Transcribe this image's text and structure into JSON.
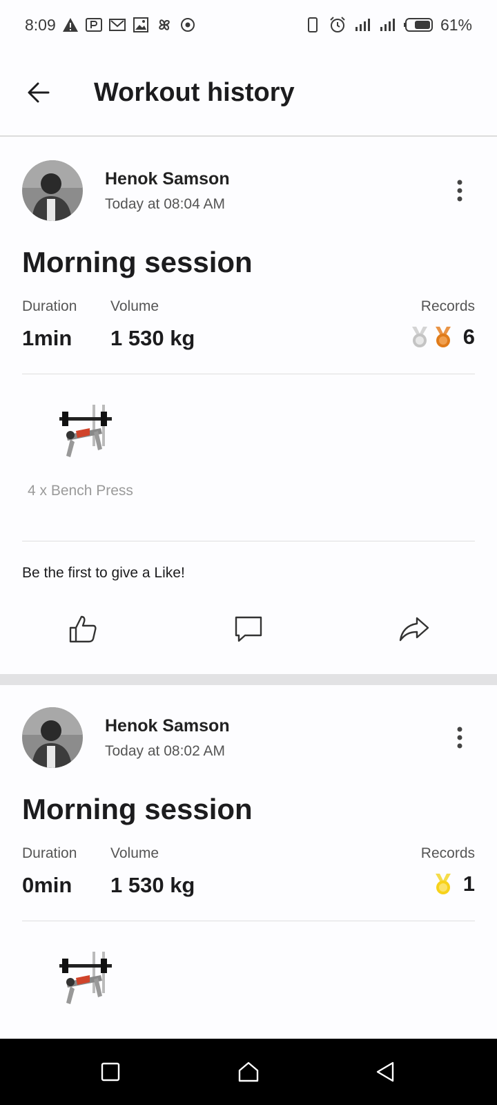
{
  "status_bar": {
    "time": "8:09",
    "battery": "61%",
    "left_icons": [
      "warning-icon",
      "parking-icon",
      "mail-icon",
      "image-icon",
      "pinwheel-icon",
      "target-icon"
    ],
    "right_icons": [
      "phone-icon",
      "alarm-icon",
      "signal-icon",
      "signal-icon",
      "battery-icon"
    ]
  },
  "app_bar": {
    "title": "Workout history",
    "back_icon": "arrow-left-icon"
  },
  "workouts": [
    {
      "user": "Henok Samson",
      "time": "Today at 08:04 AM",
      "title": "Morning session",
      "duration_label": "Duration",
      "duration": "1min",
      "volume_label": "Volume",
      "volume": "1 530 kg",
      "records_label": "Records",
      "records": "6",
      "medals": [
        "silver",
        "bronze"
      ],
      "exercise": "4 x Bench Press",
      "like_text": "Be the first to give a Like!"
    },
    {
      "user": "Henok Samson",
      "time": "Today at 08:02 AM",
      "title": "Morning session",
      "duration_label": "Duration",
      "duration": "0min",
      "volume_label": "Volume",
      "volume": "1 530 kg",
      "records_label": "Records",
      "records": "1",
      "medals": [
        "gold"
      ]
    }
  ],
  "colors": {
    "silver": "#c4c4c4",
    "bronze": "#e07b1a",
    "gold": "#f7d21a",
    "divider": "#dedede"
  }
}
